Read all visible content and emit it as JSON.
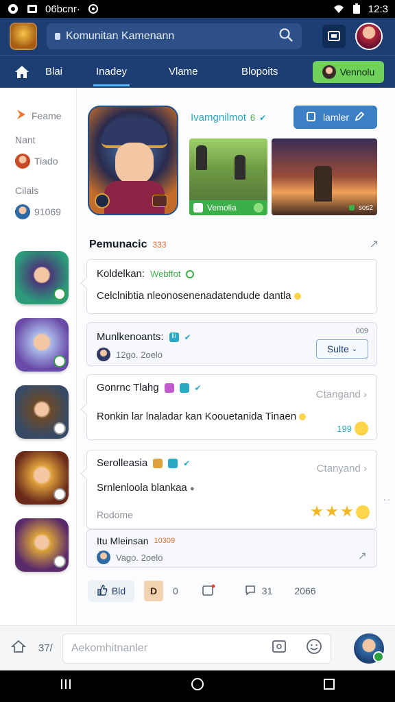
{
  "status": {
    "carrier": "06bcnr·",
    "time": "12:3"
  },
  "topbar": {
    "search_text": "Komunitan Kamenann"
  },
  "nav": {
    "items": [
      {
        "label": "Blai"
      },
      {
        "label": "Inadey"
      },
      {
        "label": "Vlame"
      },
      {
        "label": "Blopoits"
      }
    ],
    "cta_label": "Vennolu"
  },
  "sidebar": {
    "row1": "Feame",
    "row2": "Nant",
    "row3": "Tiado",
    "row4": "Cilals",
    "row5": "91069"
  },
  "hero": {
    "name": "Ivamgnilmot",
    "name_tag": "6",
    "follow_label": "lamler",
    "shot1_label": "Vemolia",
    "shot2_label": "sos2"
  },
  "section": {
    "title": "Pemunacic",
    "count": "333"
  },
  "cards": [
    {
      "title": "Koldelkan:",
      "tag": "Webffot",
      "body": "Celclnibtia nleonosenenadatendude dantla"
    },
    {
      "title": "Munlkenoants:",
      "tag": "lli",
      "meta": "12go. 2oelo",
      "top_right": "009",
      "button": "Sulte"
    },
    {
      "title": "Gonrnc Tlahg",
      "right_label": "Ctangand",
      "body": "Ronkin lar lnaladar kan Koouetanida Tinaen",
      "count": "199"
    },
    {
      "title": "Serolleasia",
      "right_label": "Ctanyand",
      "body": "Srnlenloola blankaa",
      "footer": "Rodome"
    },
    {
      "title": "Itu Mleinsan",
      "tag": "10309",
      "meta": "Vago. 2oelo"
    }
  ],
  "actions": {
    "like_label": "Bld",
    "d_label": "D",
    "count1": "0",
    "count2": "31",
    "count3": "2066"
  },
  "bottom": {
    "left_count": "37/",
    "placeholder": "Aekomhitnanler"
  }
}
